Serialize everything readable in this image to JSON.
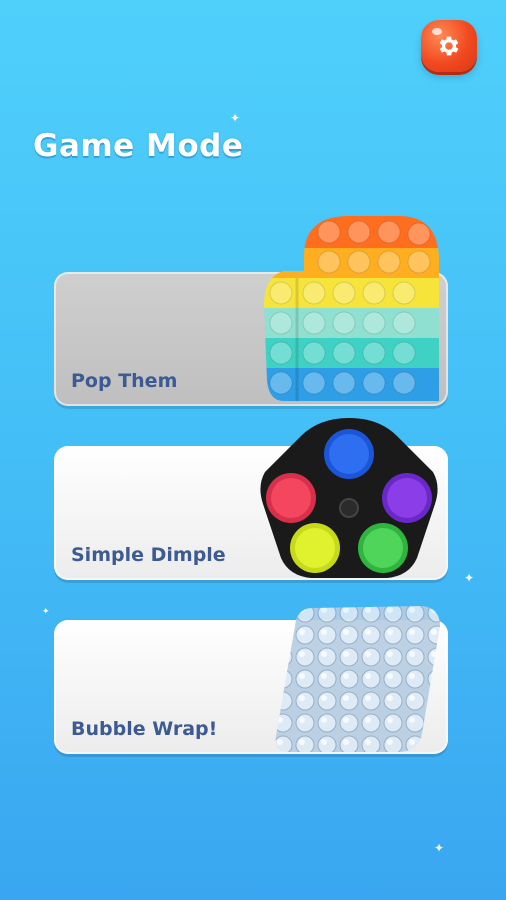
{
  "header": {
    "title": "Game Mode"
  },
  "settings": {
    "icon": "gear-icon"
  },
  "modes": [
    {
      "label": "Pop Them",
      "image": "rainbow-pop-it-toy"
    },
    {
      "label": "Simple Dimple",
      "image": "simple-dimple-spinner"
    },
    {
      "label": "Bubble Wrap!",
      "image": "bubble-wrap-sheet"
    }
  ]
}
